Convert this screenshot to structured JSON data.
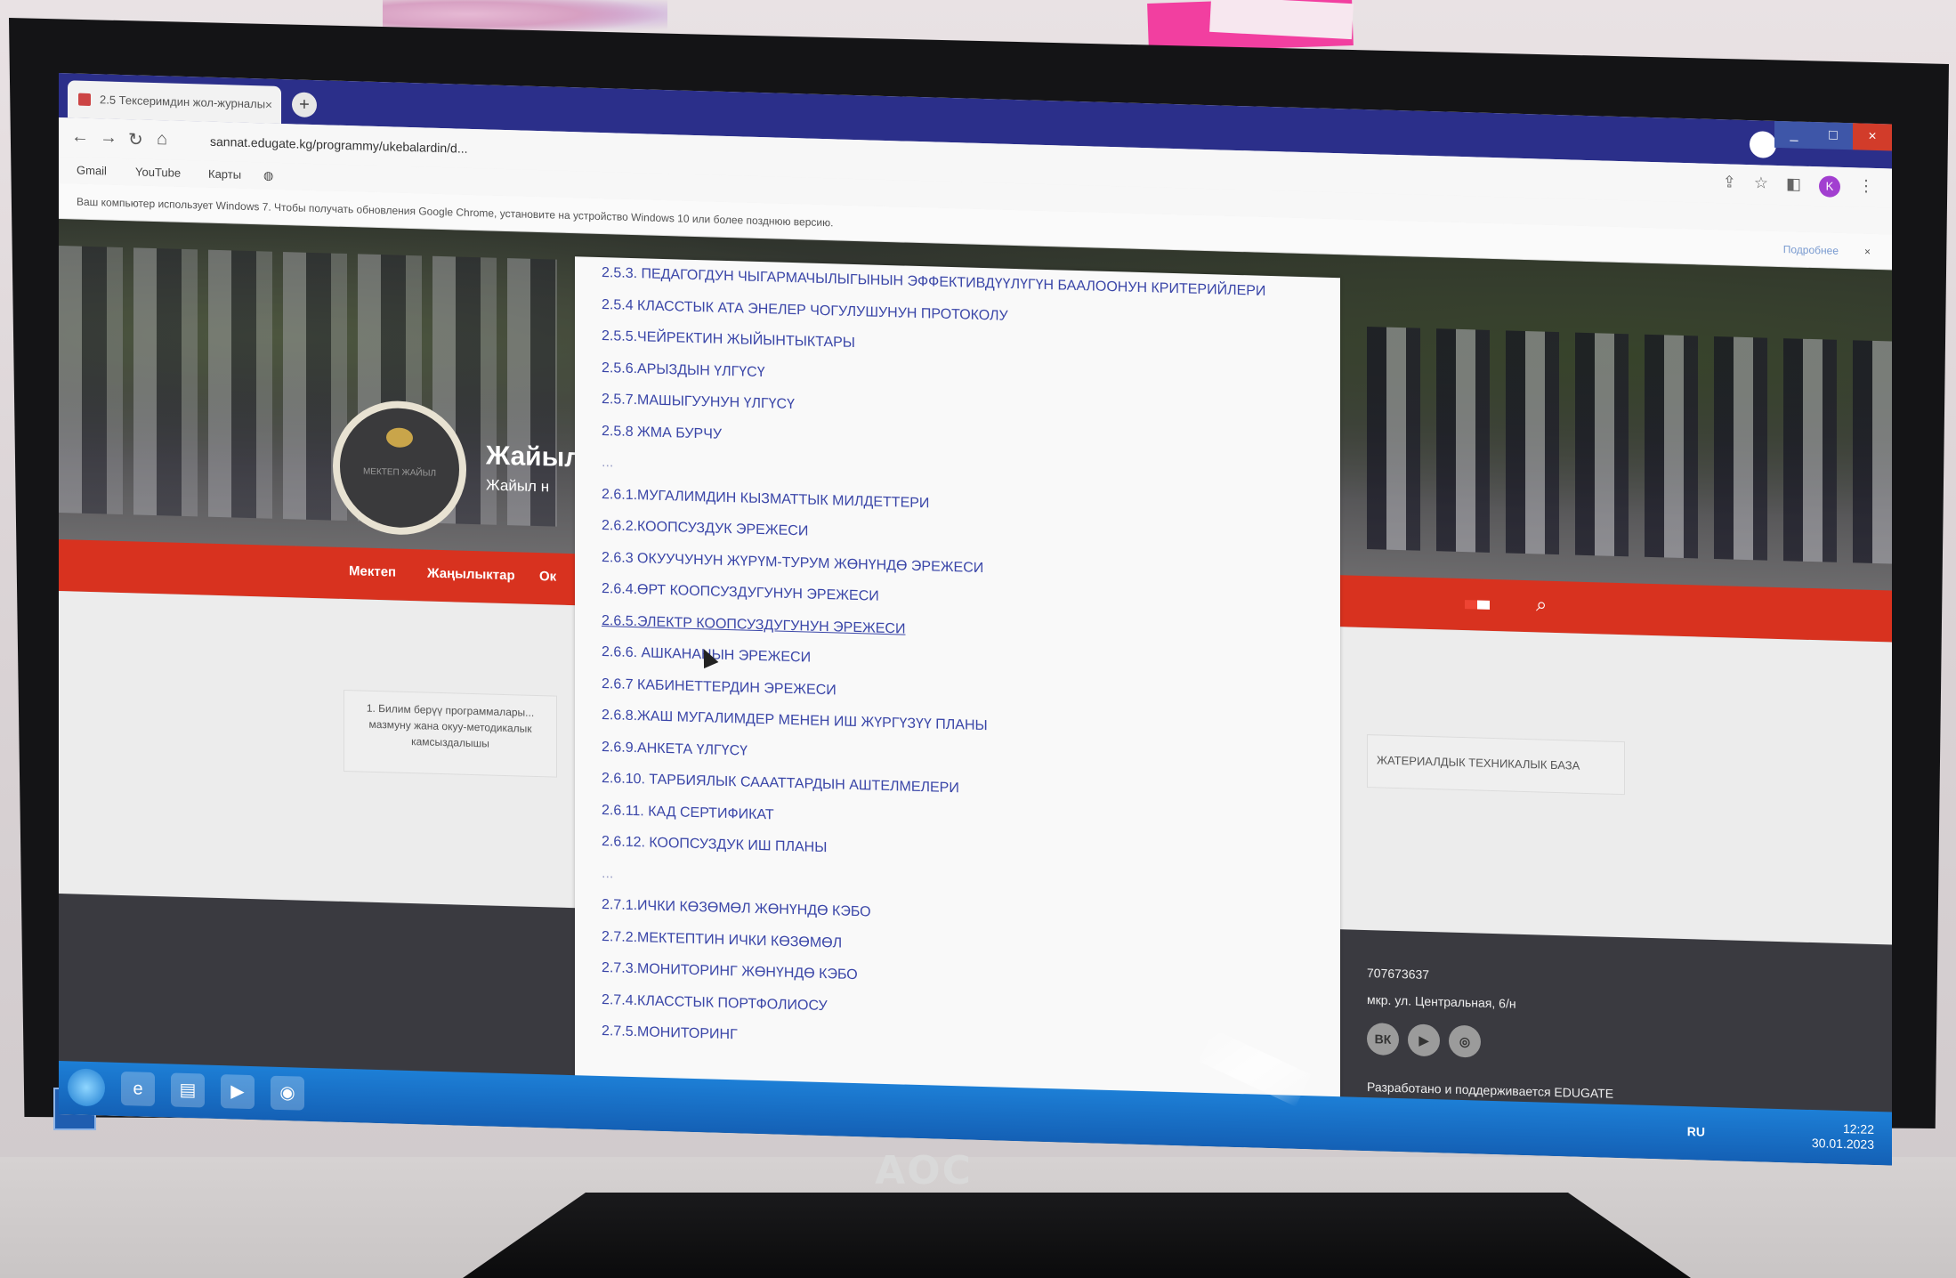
{
  "browser": {
    "tab_title": "2.5 Тексеримдин жол-журналы",
    "tab_close": "×",
    "new_tab": "+",
    "url": "sannat.edugate.kg/programmy/ukebalardin/d...",
    "bookmarks": [
      "Gmail",
      "YouTube",
      "Карты"
    ],
    "infobar_text": "Ваш компьютер использует Windows 7. Чтобы получать обновления Google Chrome, установите на устройство Windows 10 или более позднюю версию.",
    "infobar_more": "Подробнее",
    "infobar_close": "×",
    "avatar": "K",
    "window_min": "_",
    "window_max": "□",
    "window_close": "×"
  },
  "site": {
    "logo_text": "МЕКТЕП ЖАЙЫЛ",
    "title": "Жайыл",
    "subtitle": "Жайыл н",
    "menu": [
      "Мектеп",
      "Жаңылыктар",
      "Ок"
    ],
    "card_left": "1. Билим берүү программалары... мазмуну жана окуу-методикалык камсыздалышы",
    "card_right": "ЖАТЕРИАЛДЫК ТЕХНИКАЛЫК БАЗА",
    "footer_phone": "707673637",
    "footer_address": "мкр. ул. Центральная, 6/н",
    "social": [
      "ВК",
      "▶",
      "◎"
    ],
    "footer_credit": "Разработано и поддерживается EDUGATE"
  },
  "dropdown": {
    "items": [
      "2.5.3. ПЕДАГОГДУН ЧЫГАРМАЧЫЛЫГЫНЫН ЭФФЕКТИВДҮҮЛҮГҮН БААЛООНУН КРИТЕРИЙЛЕРИ",
      "2.5.4 КЛАССТЫК АТА ЭНЕЛЕР ЧОГУЛУШУНУН ПРОТОКОЛУ",
      "2.5.5.ЧЕЙРЕКТИН ЖЫЙЫНТЫКТАРЫ",
      "2.5.6.АРЫЗДЫН ҮЛГҮСҮ",
      "2.5.7.МАШЫГУУНУН ҮЛГҮСҮ",
      "2.5.8 ЖМА БУРЧУ",
      "...",
      "2.6.1.МУГАЛИМДИН КЫЗМАТТЫК МИЛДЕТТЕРИ",
      "2.6.2.КООПСУЗДУК ЭРЕЖЕСИ",
      "2.6.3 ОКУУЧУНУН ЖҮРҮМ-ТУРУМ ЖӨНҮНДӨ ЭРЕЖЕСИ",
      "2.6.4.ӨРТ КООПСУЗДУГУНУН ЭРЕЖЕСИ",
      "2.6.5.ЭЛЕКТР КООПСУЗДУГУНУН ЭРЕЖЕСИ",
      "2.6.6. АШКАНАНЫН ЭРЕЖЕСИ",
      "2.6.7 КАБИНЕТТЕРДИН ЭРЕЖЕСИ",
      "2.6.8.ЖАШ МУГАЛИМДЕР МЕНЕН ИШ ЖҮРГҮЗҮҮ ПЛАНЫ",
      "2.6.9.АНКЕТА ҮЛГҮСҮ",
      "2.6.10. ТАРБИЯЛЫК САААТТАРДЫН АШТЕЛМЕЛЕРИ",
      "2.6.11. КАД СЕРТИФИКАТ",
      "2.6.12. КООПСУЗДУК ИШ ПЛАНЫ",
      "...",
      "2.7.1.ИЧКИ КӨЗӨМӨЛ ЖӨНҮНДӨ КЭБО",
      "2.7.2.МЕКТЕПТИН ИЧКИ КӨЗӨМӨЛ",
      "2.7.3.МОНИТОРИНГ ЖӨНҮНДӨ КЭБО",
      "2.7.4.КЛАССТЫК ПОРТФОЛИОСУ",
      "2.7.5.МОНИТОРИНГ"
    ]
  },
  "taskbar": {
    "lang": "RU",
    "time": "12:22",
    "date": "30.01.2023"
  },
  "monitor": {
    "brand": "AOC"
  }
}
